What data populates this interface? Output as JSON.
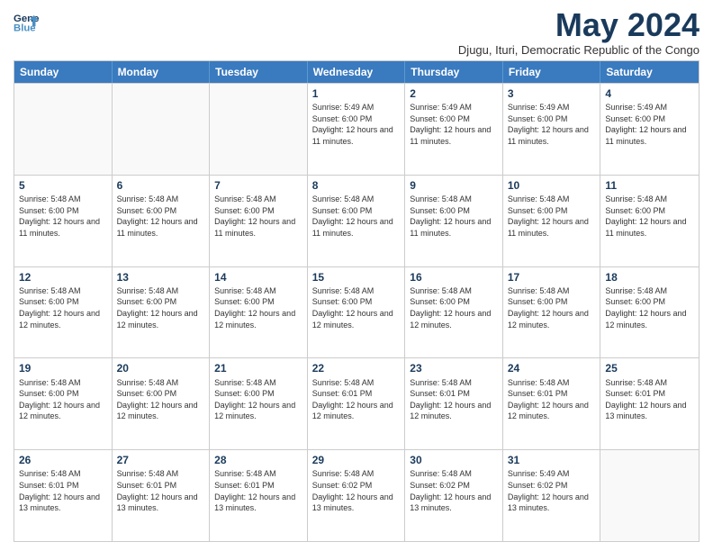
{
  "logo": {
    "line1": "General",
    "line2": "Blue"
  },
  "title": "May 2024",
  "subtitle": "Djugu, Ituri, Democratic Republic of the Congo",
  "days": [
    "Sunday",
    "Monday",
    "Tuesday",
    "Wednesday",
    "Thursday",
    "Friday",
    "Saturday"
  ],
  "weeks": [
    [
      {
        "day": "",
        "info": ""
      },
      {
        "day": "",
        "info": ""
      },
      {
        "day": "",
        "info": ""
      },
      {
        "day": "1",
        "info": "Sunrise: 5:49 AM\nSunset: 6:00 PM\nDaylight: 12 hours and 11 minutes."
      },
      {
        "day": "2",
        "info": "Sunrise: 5:49 AM\nSunset: 6:00 PM\nDaylight: 12 hours and 11 minutes."
      },
      {
        "day": "3",
        "info": "Sunrise: 5:49 AM\nSunset: 6:00 PM\nDaylight: 12 hours and 11 minutes."
      },
      {
        "day": "4",
        "info": "Sunrise: 5:49 AM\nSunset: 6:00 PM\nDaylight: 12 hours and 11 minutes."
      }
    ],
    [
      {
        "day": "5",
        "info": "Sunrise: 5:48 AM\nSunset: 6:00 PM\nDaylight: 12 hours and 11 minutes."
      },
      {
        "day": "6",
        "info": "Sunrise: 5:48 AM\nSunset: 6:00 PM\nDaylight: 12 hours and 11 minutes."
      },
      {
        "day": "7",
        "info": "Sunrise: 5:48 AM\nSunset: 6:00 PM\nDaylight: 12 hours and 11 minutes."
      },
      {
        "day": "8",
        "info": "Sunrise: 5:48 AM\nSunset: 6:00 PM\nDaylight: 12 hours and 11 minutes."
      },
      {
        "day": "9",
        "info": "Sunrise: 5:48 AM\nSunset: 6:00 PM\nDaylight: 12 hours and 11 minutes."
      },
      {
        "day": "10",
        "info": "Sunrise: 5:48 AM\nSunset: 6:00 PM\nDaylight: 12 hours and 11 minutes."
      },
      {
        "day": "11",
        "info": "Sunrise: 5:48 AM\nSunset: 6:00 PM\nDaylight: 12 hours and 11 minutes."
      }
    ],
    [
      {
        "day": "12",
        "info": "Sunrise: 5:48 AM\nSunset: 6:00 PM\nDaylight: 12 hours and 12 minutes."
      },
      {
        "day": "13",
        "info": "Sunrise: 5:48 AM\nSunset: 6:00 PM\nDaylight: 12 hours and 12 minutes."
      },
      {
        "day": "14",
        "info": "Sunrise: 5:48 AM\nSunset: 6:00 PM\nDaylight: 12 hours and 12 minutes."
      },
      {
        "day": "15",
        "info": "Sunrise: 5:48 AM\nSunset: 6:00 PM\nDaylight: 12 hours and 12 minutes."
      },
      {
        "day": "16",
        "info": "Sunrise: 5:48 AM\nSunset: 6:00 PM\nDaylight: 12 hours and 12 minutes."
      },
      {
        "day": "17",
        "info": "Sunrise: 5:48 AM\nSunset: 6:00 PM\nDaylight: 12 hours and 12 minutes."
      },
      {
        "day": "18",
        "info": "Sunrise: 5:48 AM\nSunset: 6:00 PM\nDaylight: 12 hours and 12 minutes."
      }
    ],
    [
      {
        "day": "19",
        "info": "Sunrise: 5:48 AM\nSunset: 6:00 PM\nDaylight: 12 hours and 12 minutes."
      },
      {
        "day": "20",
        "info": "Sunrise: 5:48 AM\nSunset: 6:00 PM\nDaylight: 12 hours and 12 minutes."
      },
      {
        "day": "21",
        "info": "Sunrise: 5:48 AM\nSunset: 6:00 PM\nDaylight: 12 hours and 12 minutes."
      },
      {
        "day": "22",
        "info": "Sunrise: 5:48 AM\nSunset: 6:01 PM\nDaylight: 12 hours and 12 minutes."
      },
      {
        "day": "23",
        "info": "Sunrise: 5:48 AM\nSunset: 6:01 PM\nDaylight: 12 hours and 12 minutes."
      },
      {
        "day": "24",
        "info": "Sunrise: 5:48 AM\nSunset: 6:01 PM\nDaylight: 12 hours and 12 minutes."
      },
      {
        "day": "25",
        "info": "Sunrise: 5:48 AM\nSunset: 6:01 PM\nDaylight: 12 hours and 13 minutes."
      }
    ],
    [
      {
        "day": "26",
        "info": "Sunrise: 5:48 AM\nSunset: 6:01 PM\nDaylight: 12 hours and 13 minutes."
      },
      {
        "day": "27",
        "info": "Sunrise: 5:48 AM\nSunset: 6:01 PM\nDaylight: 12 hours and 13 minutes."
      },
      {
        "day": "28",
        "info": "Sunrise: 5:48 AM\nSunset: 6:01 PM\nDaylight: 12 hours and 13 minutes."
      },
      {
        "day": "29",
        "info": "Sunrise: 5:48 AM\nSunset: 6:02 PM\nDaylight: 12 hours and 13 minutes."
      },
      {
        "day": "30",
        "info": "Sunrise: 5:48 AM\nSunset: 6:02 PM\nDaylight: 12 hours and 13 minutes."
      },
      {
        "day": "31",
        "info": "Sunrise: 5:49 AM\nSunset: 6:02 PM\nDaylight: 12 hours and 13 minutes."
      },
      {
        "day": "",
        "info": ""
      }
    ]
  ]
}
